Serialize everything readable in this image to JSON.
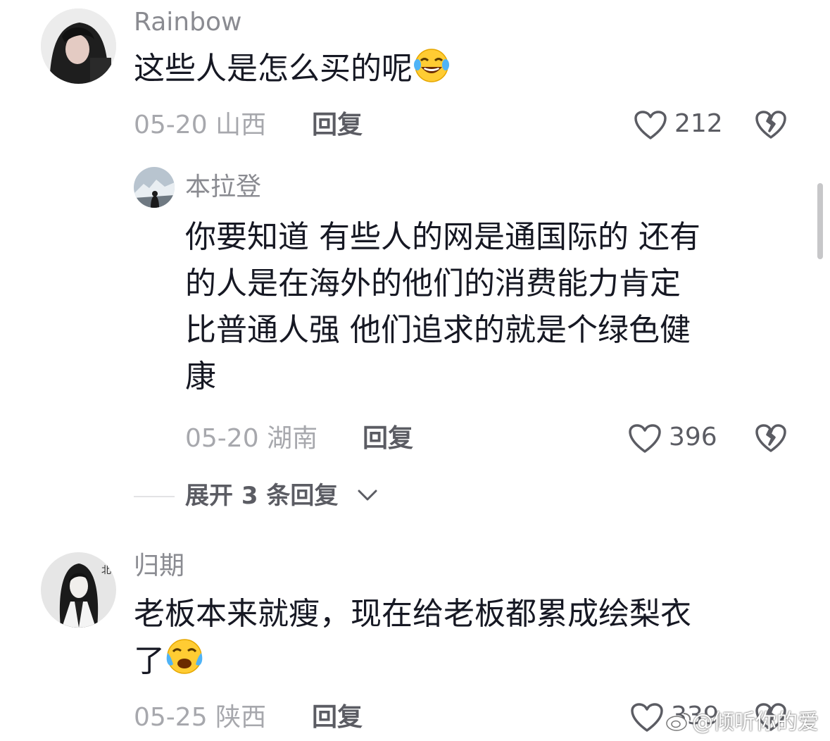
{
  "comments": [
    {
      "username": "Rainbow",
      "text": "这些人是怎么买的呢",
      "emoji": "laugh-tears-emoji",
      "date": "05-20",
      "location": "山西",
      "reply_label": "回复",
      "likes": "212"
    },
    {
      "username": "归期",
      "text_line1": "老板本来就瘦，现在给老板都累成绘梨衣",
      "text_line2": "了",
      "emoji": "crying-laugh-emoji",
      "date": "05-25",
      "location": "陕西",
      "reply_label": "回复",
      "likes": "339"
    }
  ],
  "reply": {
    "username": "本拉登",
    "lines": [
      "你要知道 有些人的网是通国际的 还有",
      "的人是在海外的他们的消费能力肯定",
      "比普通人强 他们追求的就是个绿色健",
      "康"
    ],
    "date": "05-20",
    "location": "湖南",
    "reply_label": "回复",
    "likes": "396"
  },
  "expand_replies": {
    "label": "展开 3 条回复"
  },
  "watermark": "@倾听你的爱",
  "colors": {
    "text_primary": "#161823",
    "text_secondary": "#8a8b91",
    "text_meta": "#a7a8ad",
    "icon": "#5b5c63"
  }
}
